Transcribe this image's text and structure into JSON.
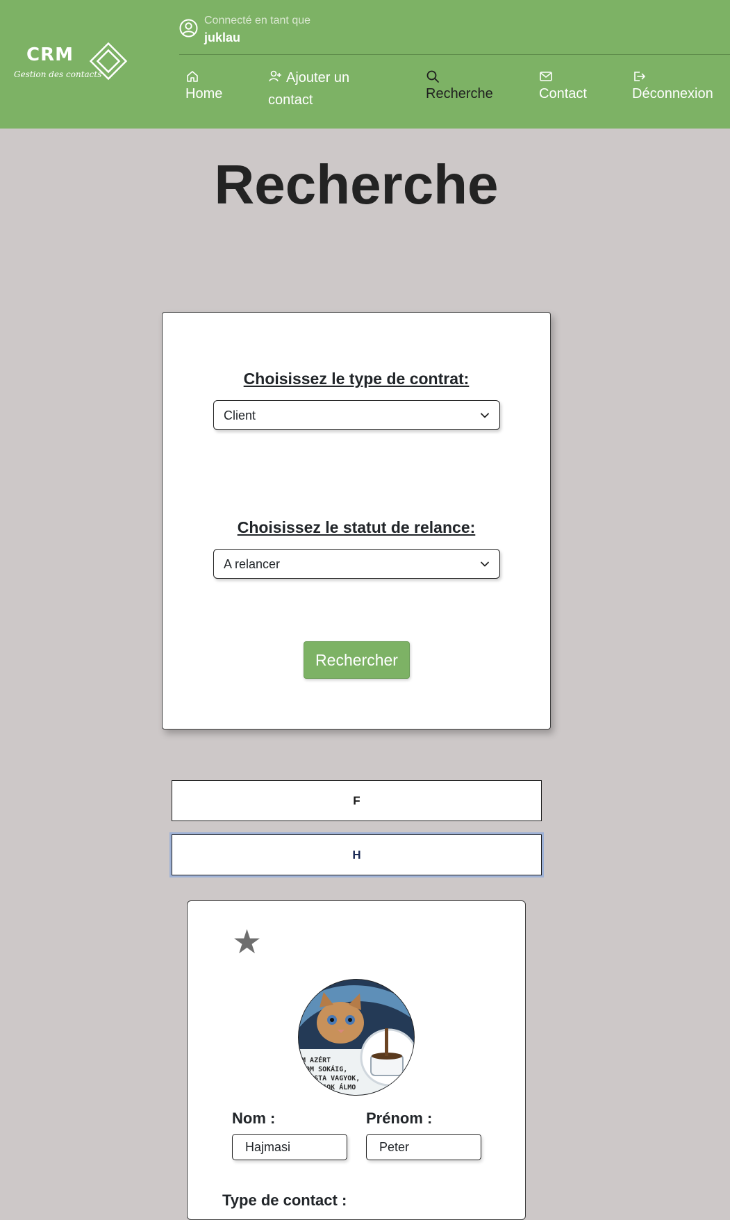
{
  "header": {
    "logo": {
      "title": "CRM",
      "tagline": "Gestion des contacts"
    },
    "user": {
      "caption": "Connecté en tant que",
      "username": "juklau"
    },
    "nav": [
      {
        "label": "Home",
        "icon": "home-icon"
      },
      {
        "label": "Ajouter un contact",
        "line1": "Ajouter un",
        "line2": "contact",
        "icon": "user-plus-icon"
      },
      {
        "label": "Recherche",
        "icon": "search-icon",
        "active": true
      },
      {
        "label": "Contact",
        "icon": "envelope-icon"
      },
      {
        "label": "Déconnexion",
        "icon": "logout-icon"
      }
    ]
  },
  "page": {
    "title": "Recherche"
  },
  "search_form": {
    "contract_label": "Choisissez le type de contrat:",
    "contract_selected": "Client",
    "followup_label": "Choisissez le statut de relance:",
    "followup_selected": "A relancer",
    "submit_label": "Rechercher"
  },
  "filters": [
    {
      "label": "F"
    },
    {
      "label": "H",
      "focused": true
    }
  ],
  "contact_card": {
    "star_icon": "star-icon",
    "avatar_caption": "EM AZÉRT\nEZOM SOKÁIG,\nT LUSTA VAGYOK,\n MERT SOK ÁLMO",
    "nom_label": "Nom :",
    "nom_value": "Hajmasi",
    "prenom_label": "Prénom :",
    "prenom_value": "Peter",
    "type_label": "Type de contact :"
  },
  "colors": {
    "header_green": "#7db265",
    "page_background": "#cdc8c8",
    "active_nav": "#1f1f1f"
  }
}
